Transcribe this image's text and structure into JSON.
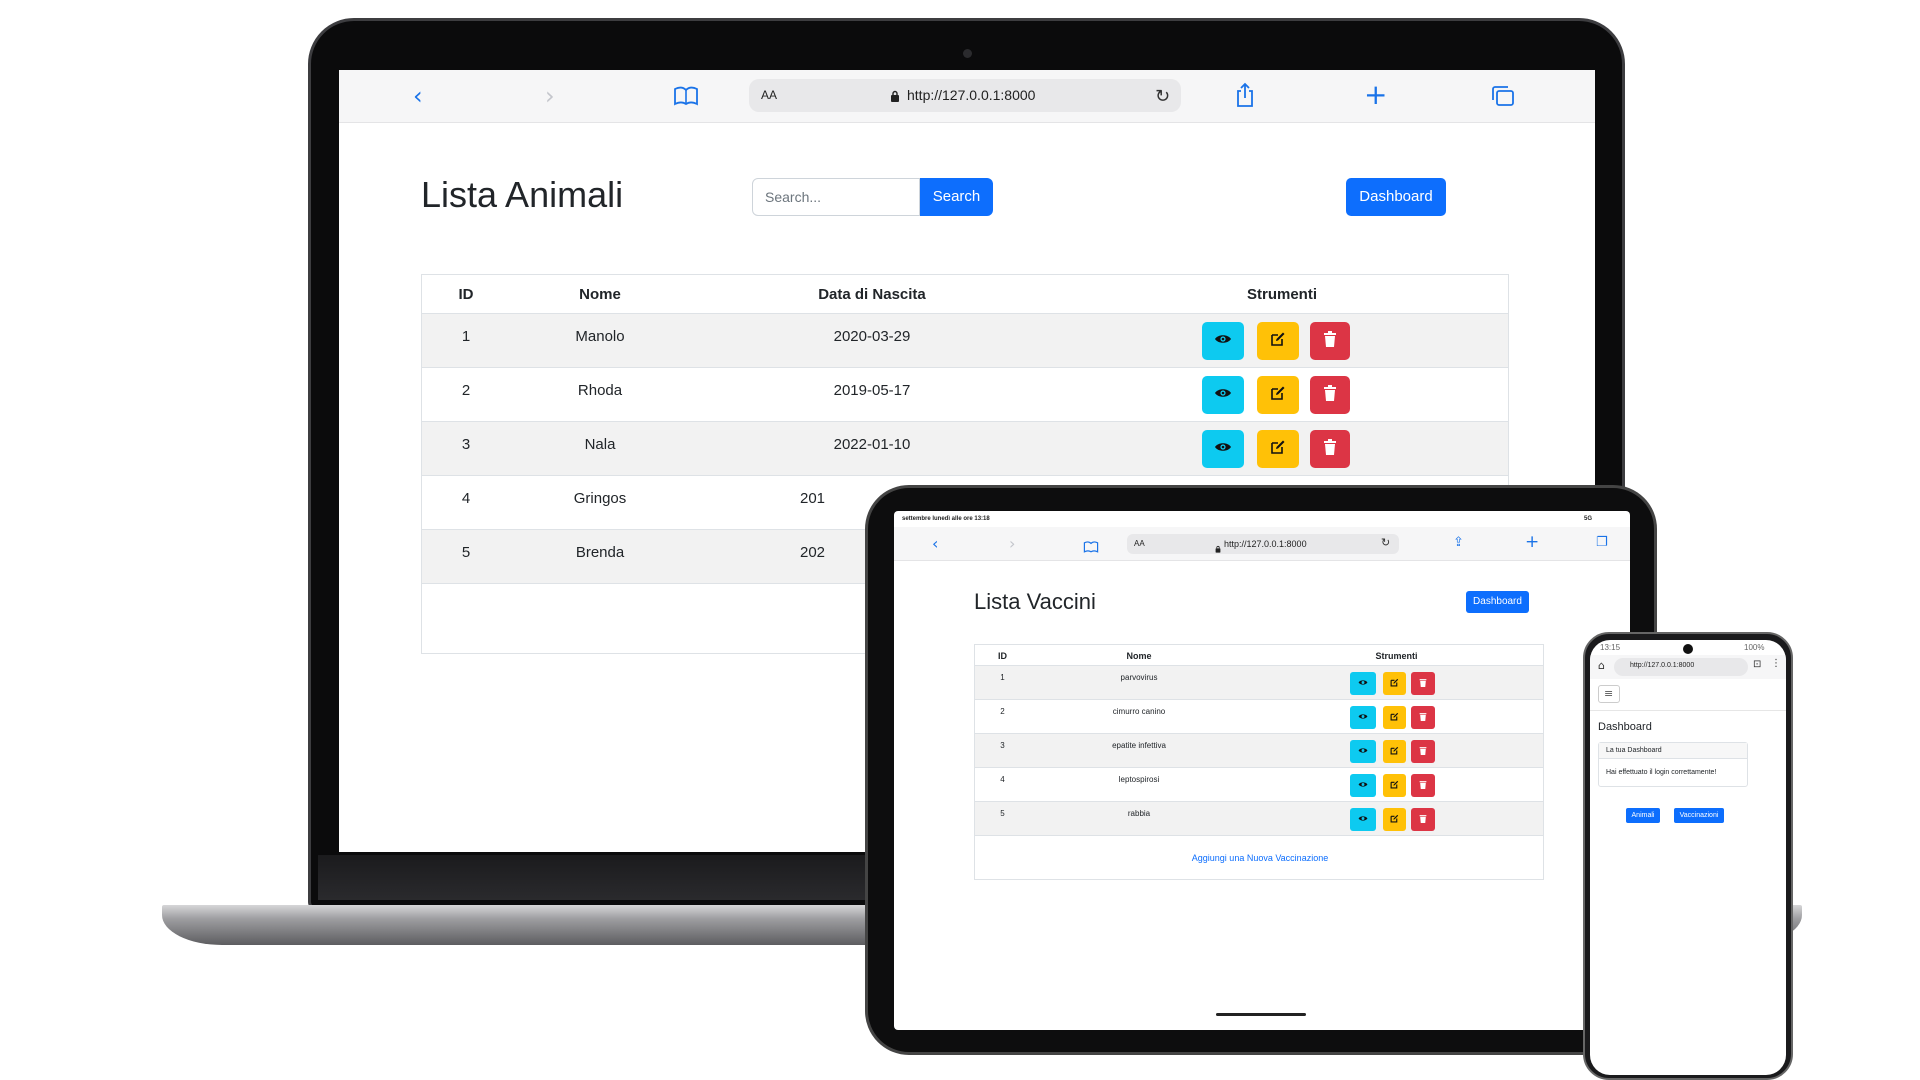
{
  "laptop": {
    "url": "http://127.0.0.1:8000",
    "text_size": "AA",
    "title": "Lista Animali",
    "search_placeholder": "Search...",
    "search_button": "Search",
    "dashboard_button": "Dashboard",
    "columns": [
      "ID",
      "Nome",
      "Data di Nascita",
      "Strumenti"
    ],
    "rows": [
      {
        "id": "1",
        "nome": "Manolo",
        "data": "2020-03-29"
      },
      {
        "id": "2",
        "nome": "Rhoda",
        "data": "2019-05-17"
      },
      {
        "id": "3",
        "nome": "Nala",
        "data": "2022-01-10"
      },
      {
        "id": "4",
        "nome": "Gringos",
        "data": "201"
      },
      {
        "id": "5",
        "nome": "Brenda",
        "data": "202"
      }
    ]
  },
  "tablet": {
    "status_left": "settembre lunedì alle ore 13:18",
    "status_right": "5G",
    "url": "http://127.0.0.1:8000",
    "text_size": "AA",
    "title": "Lista Vaccini",
    "dashboard_button": "Dashboard",
    "columns": [
      "ID",
      "Nome",
      "Strumenti"
    ],
    "rows": [
      {
        "id": "1",
        "nome": "parvovirus"
      },
      {
        "id": "2",
        "nome": "cimurro canino"
      },
      {
        "id": "3",
        "nome": "epatite infettiva"
      },
      {
        "id": "4",
        "nome": "leptospirosi"
      },
      {
        "id": "5",
        "nome": "rabbia"
      }
    ],
    "add_link": "Aggiungi una Nuova Vaccinazione"
  },
  "phone": {
    "status_time": "13:15",
    "status_battery": "100%",
    "url": "http://127.0.0.1:8000",
    "heading": "Dashboard",
    "card_header": "La tua Dashboard",
    "card_body": "Hai effettuato il login correttamente!",
    "button_animali": "Animali",
    "button_vaccinazioni": "Vaccinazioni"
  },
  "colors": {
    "primary": "#0d6efd",
    "info": "#0dcaf0",
    "warning": "#ffc107",
    "danger": "#dc3545"
  },
  "icons": [
    "back-chevron-icon",
    "forward-chevron-icon",
    "bookmarks-icon",
    "lock-icon",
    "reload-icon",
    "share-icon",
    "new-tab-icon",
    "tabs-icon",
    "eye-icon",
    "pencil-square-icon",
    "trash-icon",
    "hamburger-icon",
    "home-icon"
  ]
}
